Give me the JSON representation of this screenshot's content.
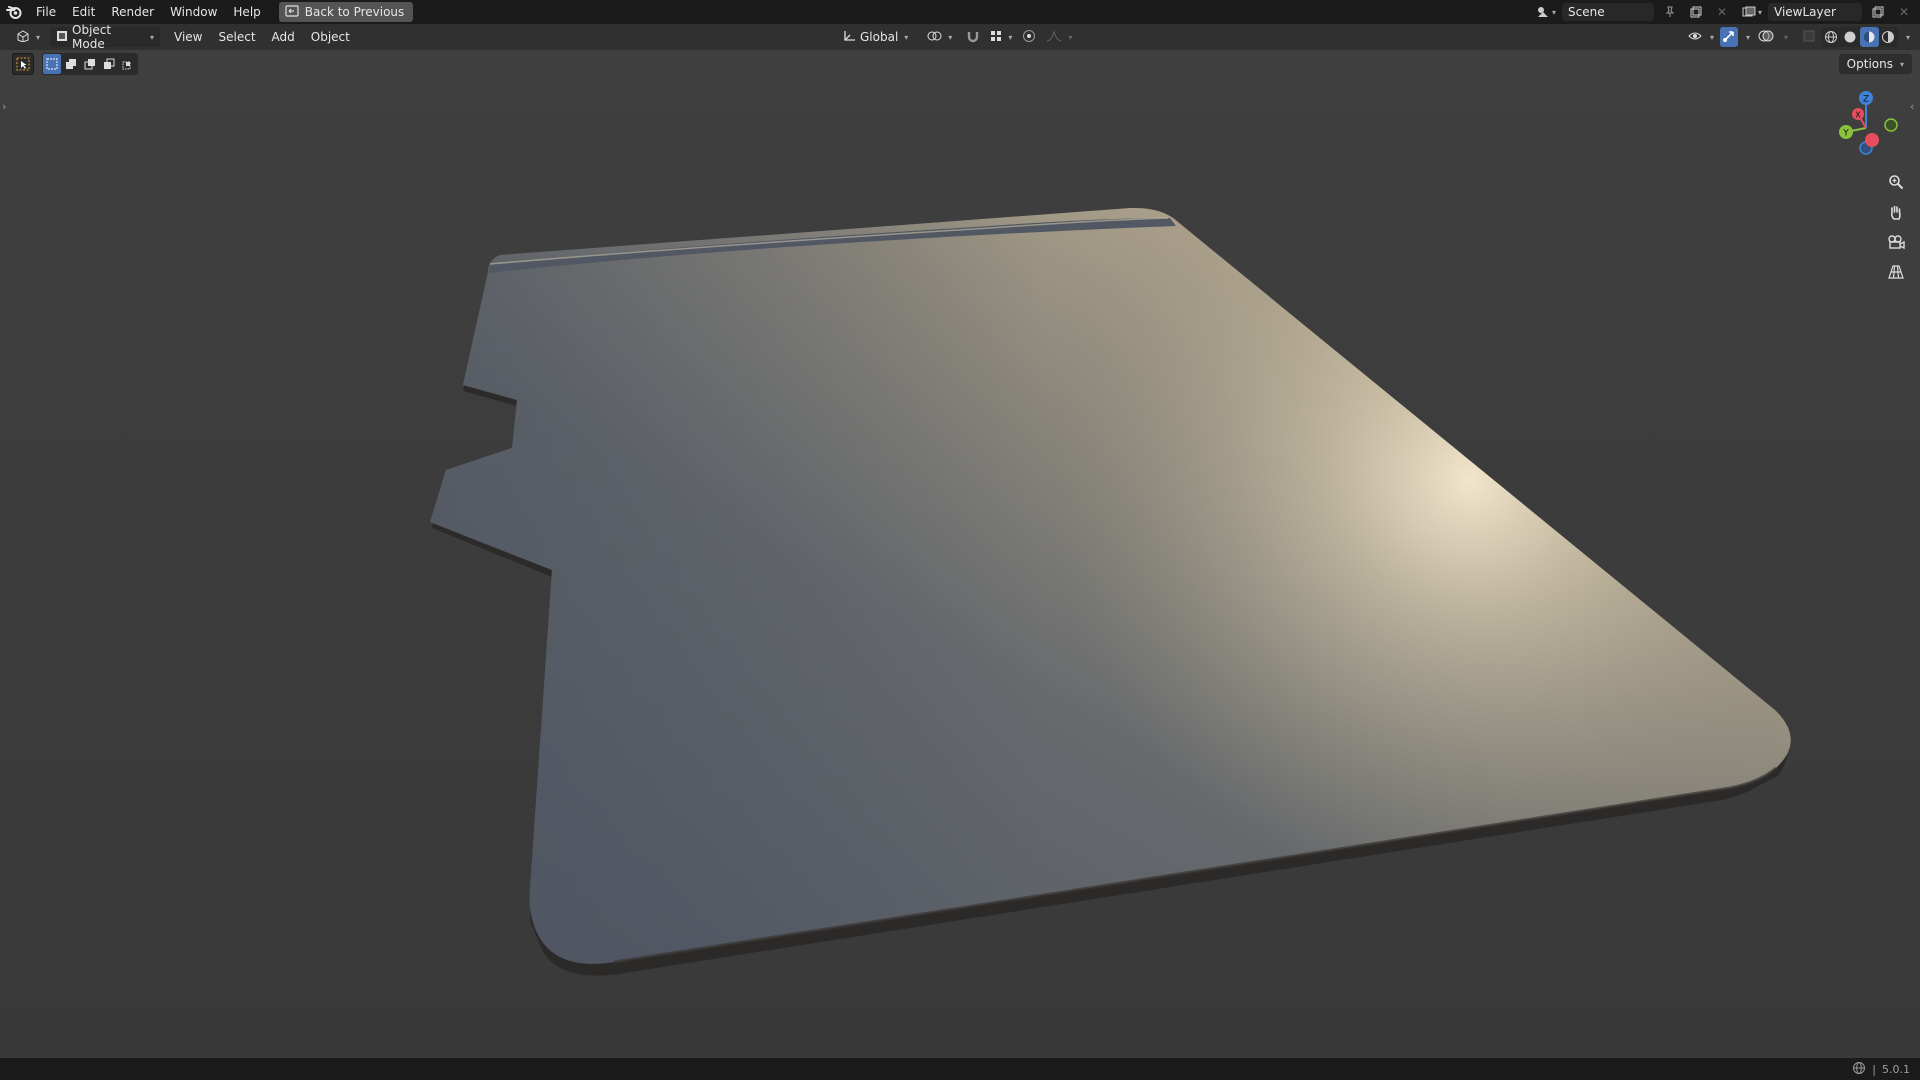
{
  "topbar": {
    "logo_icon": "blender-logo-icon",
    "menus": [
      "File",
      "Edit",
      "Render",
      "Window",
      "Help"
    ],
    "back_button": "Back to Previous",
    "scene_name": "Scene",
    "view_layer_name": "ViewLayer"
  },
  "header": {
    "editor_type_icon": "3d-viewport-icon",
    "mode": "Object Mode",
    "menus": [
      "View",
      "Select",
      "Add",
      "Object"
    ],
    "transform_orientation": "Global",
    "options_label": "Options"
  },
  "toolbar": {
    "active_tool_icon": "select-box-icon",
    "selection_modes": [
      "set-new-selection-icon",
      "extend-selection-icon",
      "subtract-selection-icon",
      "invert-selection-icon",
      "intersect-selection-icon"
    ]
  },
  "gizmo": {
    "z_label": "Z",
    "y_label": "Y",
    "x_label": "X",
    "colors": {
      "x": "#e64e5e",
      "y": "#8bc13e",
      "z": "#3d84d9"
    }
  },
  "navigation": [
    "zoom-icon",
    "pan-hand-icon",
    "camera-icon",
    "perspective-grid-icon"
  ],
  "statusbar": {
    "version": "5.0.1"
  },
  "colors": {
    "accent": "#4772b3",
    "background": "#3d3d3d",
    "bar": "#1b1b1b"
  }
}
